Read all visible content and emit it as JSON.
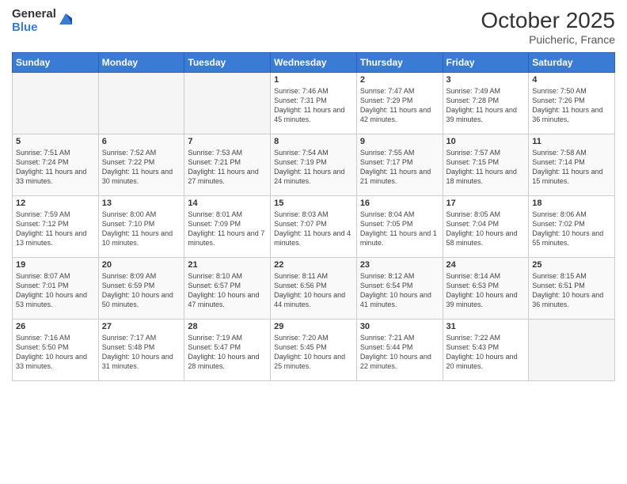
{
  "header": {
    "logo_general": "General",
    "logo_blue": "Blue",
    "month": "October 2025",
    "location": "Puicheric, France"
  },
  "days_of_week": [
    "Sunday",
    "Monday",
    "Tuesday",
    "Wednesday",
    "Thursday",
    "Friday",
    "Saturday"
  ],
  "weeks": [
    [
      {
        "day": "",
        "info": ""
      },
      {
        "day": "",
        "info": ""
      },
      {
        "day": "",
        "info": ""
      },
      {
        "day": "1",
        "info": "Sunrise: 7:46 AM\nSunset: 7:31 PM\nDaylight: 11 hours and 45 minutes."
      },
      {
        "day": "2",
        "info": "Sunrise: 7:47 AM\nSunset: 7:29 PM\nDaylight: 11 hours and 42 minutes."
      },
      {
        "day": "3",
        "info": "Sunrise: 7:49 AM\nSunset: 7:28 PM\nDaylight: 11 hours and 39 minutes."
      },
      {
        "day": "4",
        "info": "Sunrise: 7:50 AM\nSunset: 7:26 PM\nDaylight: 11 hours and 36 minutes."
      }
    ],
    [
      {
        "day": "5",
        "info": "Sunrise: 7:51 AM\nSunset: 7:24 PM\nDaylight: 11 hours and 33 minutes."
      },
      {
        "day": "6",
        "info": "Sunrise: 7:52 AM\nSunset: 7:22 PM\nDaylight: 11 hours and 30 minutes."
      },
      {
        "day": "7",
        "info": "Sunrise: 7:53 AM\nSunset: 7:21 PM\nDaylight: 11 hours and 27 minutes."
      },
      {
        "day": "8",
        "info": "Sunrise: 7:54 AM\nSunset: 7:19 PM\nDaylight: 11 hours and 24 minutes."
      },
      {
        "day": "9",
        "info": "Sunrise: 7:55 AM\nSunset: 7:17 PM\nDaylight: 11 hours and 21 minutes."
      },
      {
        "day": "10",
        "info": "Sunrise: 7:57 AM\nSunset: 7:15 PM\nDaylight: 11 hours and 18 minutes."
      },
      {
        "day": "11",
        "info": "Sunrise: 7:58 AM\nSunset: 7:14 PM\nDaylight: 11 hours and 15 minutes."
      }
    ],
    [
      {
        "day": "12",
        "info": "Sunrise: 7:59 AM\nSunset: 7:12 PM\nDaylight: 11 hours and 13 minutes."
      },
      {
        "day": "13",
        "info": "Sunrise: 8:00 AM\nSunset: 7:10 PM\nDaylight: 11 hours and 10 minutes."
      },
      {
        "day": "14",
        "info": "Sunrise: 8:01 AM\nSunset: 7:09 PM\nDaylight: 11 hours and 7 minutes."
      },
      {
        "day": "15",
        "info": "Sunrise: 8:03 AM\nSunset: 7:07 PM\nDaylight: 11 hours and 4 minutes."
      },
      {
        "day": "16",
        "info": "Sunrise: 8:04 AM\nSunset: 7:05 PM\nDaylight: 11 hours and 1 minute."
      },
      {
        "day": "17",
        "info": "Sunrise: 8:05 AM\nSunset: 7:04 PM\nDaylight: 10 hours and 58 minutes."
      },
      {
        "day": "18",
        "info": "Sunrise: 8:06 AM\nSunset: 7:02 PM\nDaylight: 10 hours and 55 minutes."
      }
    ],
    [
      {
        "day": "19",
        "info": "Sunrise: 8:07 AM\nSunset: 7:01 PM\nDaylight: 10 hours and 53 minutes."
      },
      {
        "day": "20",
        "info": "Sunrise: 8:09 AM\nSunset: 6:59 PM\nDaylight: 10 hours and 50 minutes."
      },
      {
        "day": "21",
        "info": "Sunrise: 8:10 AM\nSunset: 6:57 PM\nDaylight: 10 hours and 47 minutes."
      },
      {
        "day": "22",
        "info": "Sunrise: 8:11 AM\nSunset: 6:56 PM\nDaylight: 10 hours and 44 minutes."
      },
      {
        "day": "23",
        "info": "Sunrise: 8:12 AM\nSunset: 6:54 PM\nDaylight: 10 hours and 41 minutes."
      },
      {
        "day": "24",
        "info": "Sunrise: 8:14 AM\nSunset: 6:53 PM\nDaylight: 10 hours and 39 minutes."
      },
      {
        "day": "25",
        "info": "Sunrise: 8:15 AM\nSunset: 6:51 PM\nDaylight: 10 hours and 36 minutes."
      }
    ],
    [
      {
        "day": "26",
        "info": "Sunrise: 7:16 AM\nSunset: 5:50 PM\nDaylight: 10 hours and 33 minutes."
      },
      {
        "day": "27",
        "info": "Sunrise: 7:17 AM\nSunset: 5:48 PM\nDaylight: 10 hours and 31 minutes."
      },
      {
        "day": "28",
        "info": "Sunrise: 7:19 AM\nSunset: 5:47 PM\nDaylight: 10 hours and 28 minutes."
      },
      {
        "day": "29",
        "info": "Sunrise: 7:20 AM\nSunset: 5:45 PM\nDaylight: 10 hours and 25 minutes."
      },
      {
        "day": "30",
        "info": "Sunrise: 7:21 AM\nSunset: 5:44 PM\nDaylight: 10 hours and 22 minutes."
      },
      {
        "day": "31",
        "info": "Sunrise: 7:22 AM\nSunset: 5:43 PM\nDaylight: 10 hours and 20 minutes."
      },
      {
        "day": "",
        "info": ""
      }
    ]
  ]
}
